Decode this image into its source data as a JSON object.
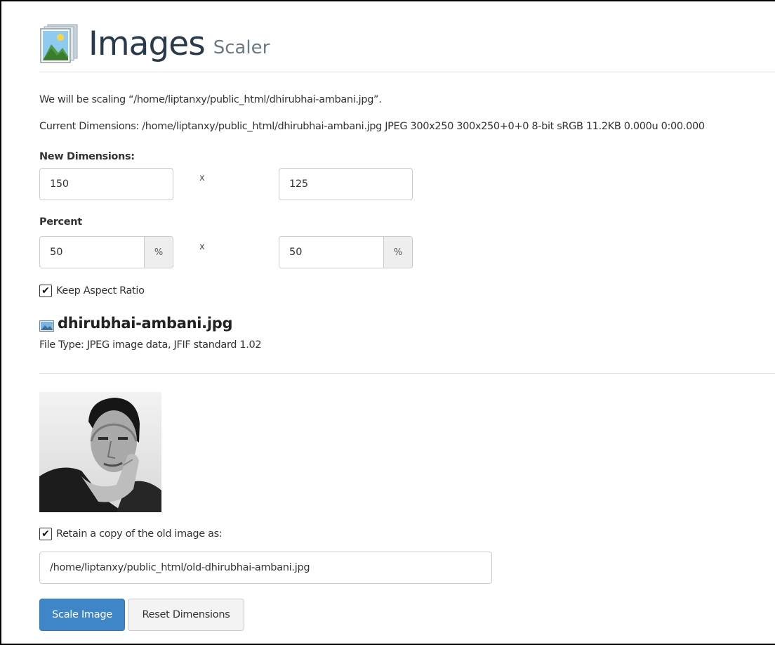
{
  "header": {
    "title": "Images",
    "subtitle": "Scaler",
    "icon": "images-app-icon"
  },
  "info": {
    "scaling_line": "We will be scaling “/home/liptanxy/public_html/dhirubhai-ambani.jpg”.",
    "current_dimensions_line": "Current Dimensions: /home/liptanxy/public_html/dhirubhai-ambani.jpg JPEG 300x250 300x250+0+0 8-bit sRGB 11.2KB 0.000u 0:00.000"
  },
  "new_dimensions": {
    "label": "New Dimensions:",
    "width": "150",
    "separator": "x",
    "height": "125"
  },
  "percent": {
    "label": "Percent",
    "width": "50",
    "width_unit": "%",
    "separator": "x",
    "height": "50",
    "height_unit": "%"
  },
  "keep_aspect_ratio": {
    "checked": true,
    "label": "Keep Aspect Ratio",
    "mark": "✔"
  },
  "file": {
    "icon": "image-file-icon",
    "name": "dhirubhai-ambani.jpg",
    "type_line": "File Type: JPEG image data, JFIF standard 1.02"
  },
  "retain_copy": {
    "checked": true,
    "label": "Retain a copy of the old image as:",
    "mark": "✔",
    "path": "/home/liptanxy/public_html/old-dhirubhai-ambani.jpg"
  },
  "actions": {
    "scale_label": "Scale Image",
    "reset_label": "Reset Dimensions"
  },
  "colors": {
    "primary": "#3e86c8",
    "title": "#293a4a",
    "subtitle": "#6b7a86",
    "rule": "#e4e4e4"
  }
}
